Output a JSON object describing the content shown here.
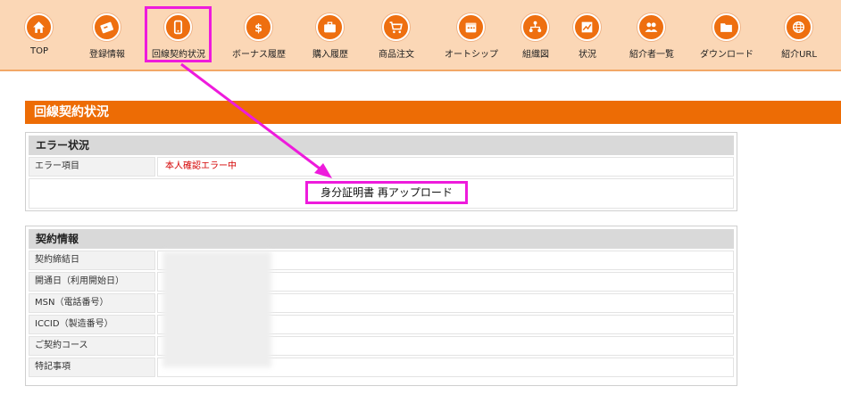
{
  "nav": {
    "items": [
      {
        "label": "TOP",
        "icon": "home-icon"
      },
      {
        "label": "登録情報",
        "icon": "id-card-icon"
      },
      {
        "label": "回線契約状況",
        "icon": "smartphone-icon"
      },
      {
        "label": "ボーナス履歴",
        "icon": "dollar-icon"
      },
      {
        "label": "購入履歴",
        "icon": "briefcase-icon"
      },
      {
        "label": "商品注文",
        "icon": "cart-icon"
      },
      {
        "label": "オートシップ",
        "icon": "calendar-icon"
      },
      {
        "label": "組織図",
        "icon": "organization-icon"
      },
      {
        "label": "状況",
        "icon": "chart-icon"
      },
      {
        "label": "紹介者一覧",
        "icon": "users-icon"
      },
      {
        "label": "ダウンロード",
        "icon": "folder-icon"
      },
      {
        "label": "紹介URL",
        "icon": "globe-icon"
      }
    ],
    "active_index": 2
  },
  "page": {
    "title": "回線契約状況"
  },
  "error_panel": {
    "header": "エラー状況",
    "rows": [
      {
        "label": "エラー項目",
        "value": "本人確認エラー中"
      }
    ],
    "reupload_button": "身分証明書 再アップロード"
  },
  "contract_panel": {
    "header": "契約情報",
    "rows": [
      {
        "label": "契約締結日",
        "value": ""
      },
      {
        "label": "開通日（利用開始日）",
        "value": ""
      },
      {
        "label": "MSN（電話番号）",
        "value": ""
      },
      {
        "label": "ICCID（製造番号）",
        "value": ""
      },
      {
        "label": "ご契約コース",
        "value": ""
      },
      {
        "label": "特記事項",
        "value": ""
      }
    ]
  },
  "colors": {
    "accent": "#ed6c05",
    "nav_bg": "#fbd7b6",
    "highlight": "#ee1bdc",
    "error": "#d40000"
  }
}
